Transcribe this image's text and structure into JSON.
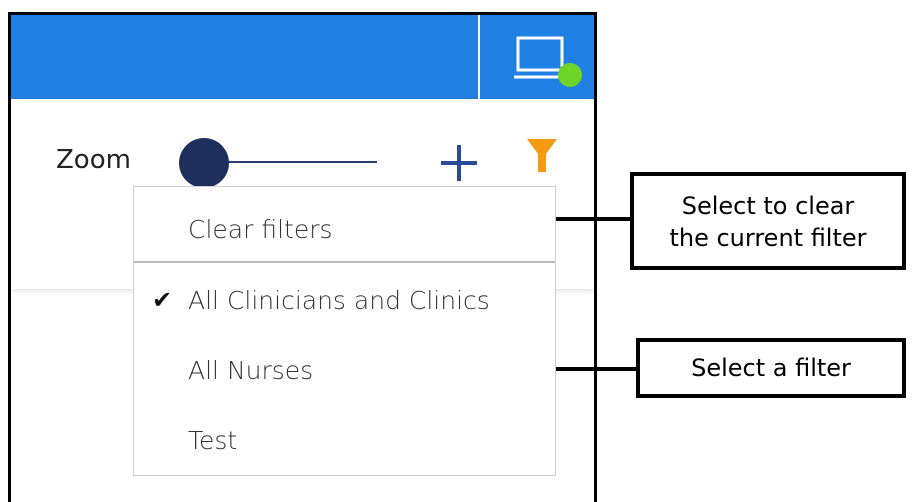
{
  "toolbar": {
    "zoom_label": "Zoom",
    "zoom_icon": "plus-icon",
    "filter_icon": "filter-icon"
  },
  "topbar": {
    "accent_color": "#2080e4",
    "status_icon": "screen-online-icon",
    "status_color": "#6fd42a"
  },
  "filter_menu": {
    "clear_label": "Clear filters",
    "items": [
      {
        "label": "All Clinicians and Clinics",
        "selected": true
      },
      {
        "label": "All Nurses",
        "selected": false
      },
      {
        "label": "Test",
        "selected": false
      }
    ],
    "check_glyph": "✔"
  },
  "annotations": {
    "clear_callout_line1": "Select to clear",
    "clear_callout_line2": "the current filter",
    "filter_callout": "Select a filter"
  }
}
